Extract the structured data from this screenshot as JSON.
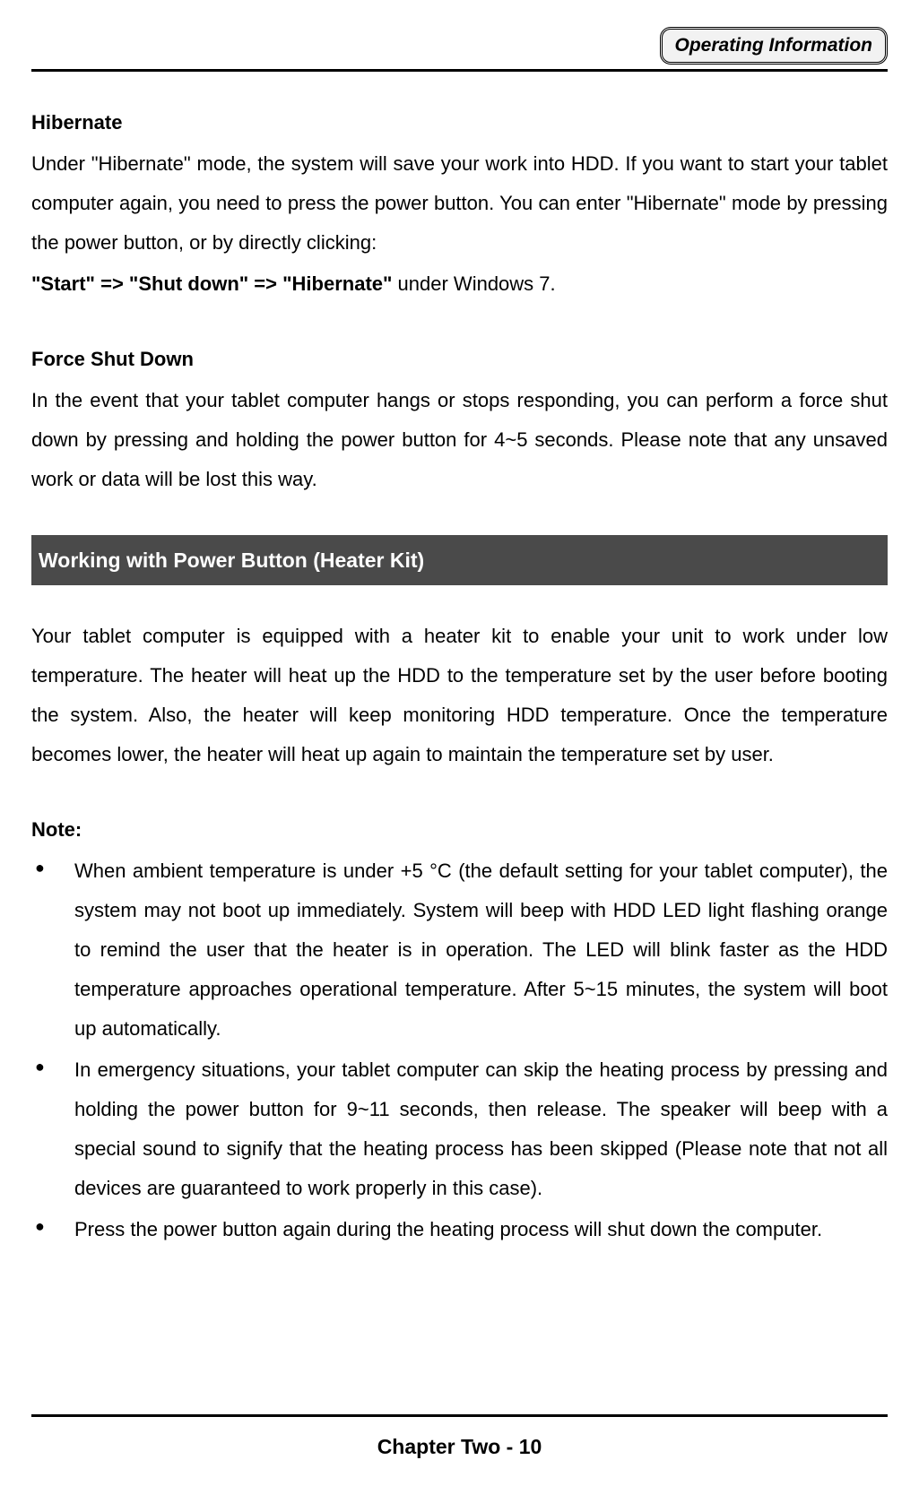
{
  "header": {
    "badge": "Operating Information"
  },
  "section1": {
    "heading": "Hibernate",
    "para1": "Under \"Hibernate\" mode, the system will save your work into HDD. If you want to start your tablet computer again, you need to press the power button. You can enter \"Hibernate\" mode by pressing the power button, or by directly clicking:",
    "pathBold": "\"Start\" => \"Shut down\" => \"Hibernate\"",
    "pathRest": " under Windows 7."
  },
  "section2": {
    "heading": "Force Shut Down",
    "para": "In the event that your tablet computer hangs or stops responding, you can perform a force shut down by pressing and holding the power button for 4~5 seconds. Please note that any unsaved work or data will be lost this way."
  },
  "sectionBar": " Working with Power Button (Heater Kit)                                              ",
  "section3": {
    "para": "Your tablet computer is equipped with a heater kit to enable your unit to work under low temperature. The heater will heat up the HDD to the temperature set by the user before booting the system. Also, the heater will keep monitoring HDD temperature. Once the temperature becomes lower, the heater will heat up again to maintain the temperature set by user."
  },
  "note": {
    "heading": "Note:",
    "items": [
      "When ambient temperature is under +5 °C (the default setting for your tablet computer), the system may not boot up immediately. System will beep with HDD LED light flashing orange to remind the user that the heater is in operation. The LED will blink faster as the HDD temperature approaches operational temperature. After 5~15 minutes, the system will boot up automatically.",
      "In emergency situations, your tablet computer can skip the heating process by pressing and holding the power button for 9~11 seconds, then release. The speaker will beep with a special sound to signify that the heating process has been skipped (Please note that not all devices are guaranteed to work properly in this case).",
      "Press the power button again during the heating process will shut down the computer."
    ]
  },
  "footer": {
    "pageLabel": "Chapter Two - 10"
  }
}
